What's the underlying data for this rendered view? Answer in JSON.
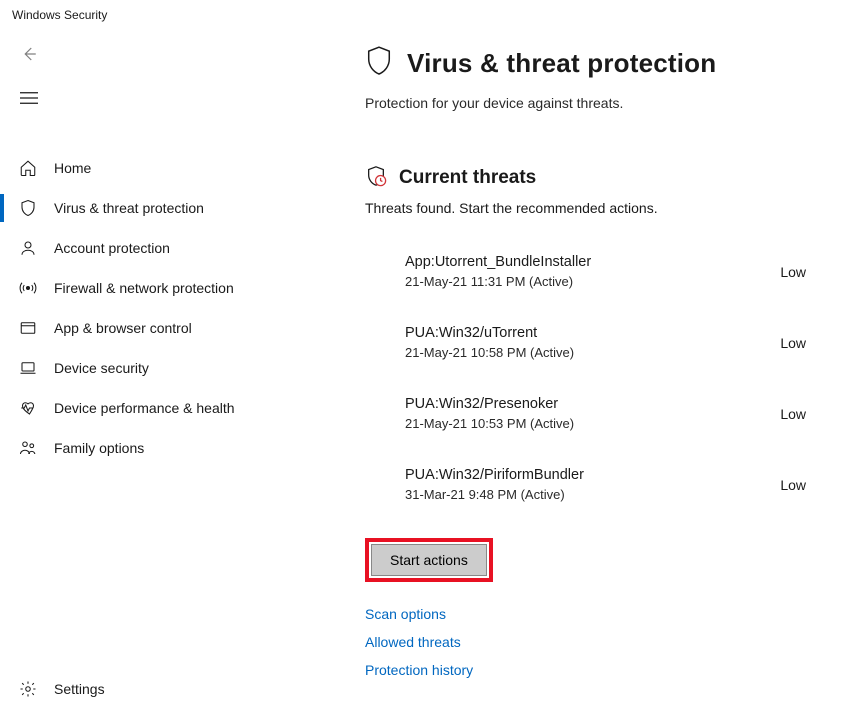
{
  "window": {
    "title": "Windows Security"
  },
  "sidebar": {
    "items": [
      {
        "icon": "home-icon",
        "label": "Home"
      },
      {
        "icon": "shield-icon",
        "label": "Virus & threat protection",
        "selected": true
      },
      {
        "icon": "person-icon",
        "label": "Account protection"
      },
      {
        "icon": "broadcast-icon",
        "label": "Firewall & network protection"
      },
      {
        "icon": "browser-icon",
        "label": "App & browser control"
      },
      {
        "icon": "laptop-icon",
        "label": "Device security"
      },
      {
        "icon": "heart-icon",
        "label": "Device performance & health"
      },
      {
        "icon": "family-icon",
        "label": "Family options"
      }
    ],
    "settings_label": "Settings"
  },
  "page": {
    "title": "Virus & threat protection",
    "subtitle": "Protection for your device against threats."
  },
  "current_threats": {
    "title": "Current threats",
    "subtitle": "Threats found. Start the recommended actions.",
    "items": [
      {
        "name": "App:Utorrent_BundleInstaller",
        "meta": "21-May-21 11:31 PM (Active)",
        "severity": "Low"
      },
      {
        "name": "PUA:Win32/uTorrent",
        "meta": "21-May-21 10:58 PM (Active)",
        "severity": "Low"
      },
      {
        "name": "PUA:Win32/Presenoker",
        "meta": "21-May-21 10:53 PM (Active)",
        "severity": "Low"
      },
      {
        "name": "PUA:Win32/PiriformBundler",
        "meta": "31-Mar-21 9:48 PM (Active)",
        "severity": "Low"
      }
    ],
    "start_actions_label": "Start actions",
    "links": [
      "Scan options",
      "Allowed threats",
      "Protection history"
    ]
  }
}
